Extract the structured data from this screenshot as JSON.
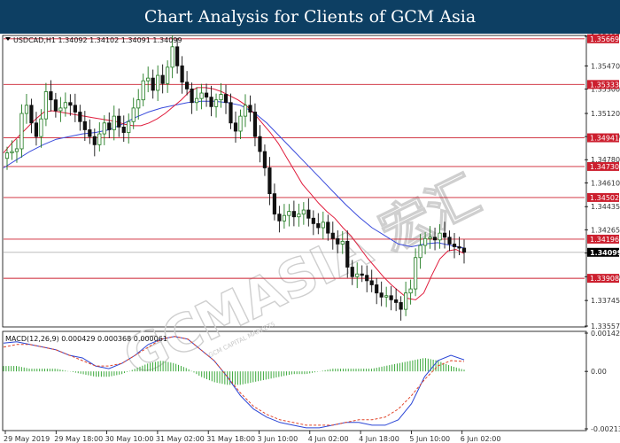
{
  "header": {
    "title": "Chart Analysis for Clients of GCM Asia"
  },
  "watermark": {
    "text": "GCMASIA 宏汇",
    "subtext": "GCM CAPITAL MARKETS"
  },
  "chart_data": [
    {
      "type": "candlestick",
      "symbol_info": "USDCAD,H1  1.34092 1.34102 1.34091 1.34099",
      "ylim": [
        1.33557,
        1.35687
      ],
      "y_ticks": [
        "1.35687",
        "1.35470",
        "1.35300",
        "1.35120",
        "1.34950",
        "1.34780",
        "1.34610",
        "1.34435",
        "1.34265",
        "1.34095",
        "1.33920",
        "1.33745",
        "1.33557"
      ],
      "x_labels": [
        "29 May 2019",
        "29 May 18:00",
        "30 May 10:00",
        "31 May 02:00",
        "31 May 18:00",
        "3 Jun 10:00",
        "4 Jun 02:00",
        "4 Jun 18:00",
        "5 Jun 10:00",
        "6 Jun 02:00"
      ],
      "current_price": "1.34099",
      "levels": [
        {
          "label": "1.35669",
          "value": 1.35669
        },
        {
          "label": "1.35333",
          "value": 1.35333
        },
        {
          "label": "1.34941",
          "value": 1.34941
        },
        {
          "label": "1.34730",
          "value": 1.3473
        },
        {
          "label": "1.34502",
          "value": 1.34502
        },
        {
          "label": "1.34196",
          "value": 1.34196
        },
        {
          "label": "1.33908",
          "value": 1.33908
        }
      ],
      "close_series": [
        1.3483,
        1.3484,
        1.3486,
        1.3512,
        1.3518,
        1.3505,
        1.3495,
        1.3508,
        1.3528,
        1.3522,
        1.3514,
        1.3516,
        1.352,
        1.3518,
        1.3513,
        1.3506,
        1.35,
        1.3495,
        1.3489,
        1.3497,
        1.3505,
        1.35,
        1.351,
        1.3502,
        1.3498,
        1.3506,
        1.3516,
        1.3522,
        1.3536,
        1.3538,
        1.3529,
        1.354,
        1.3534,
        1.3546,
        1.3561,
        1.3547,
        1.3535,
        1.353,
        1.352,
        1.3523,
        1.3527,
        1.3524,
        1.3517,
        1.3522,
        1.3526,
        1.352,
        1.3505,
        1.3499,
        1.351,
        1.3518,
        1.3513,
        1.3495,
        1.3484,
        1.3472,
        1.3453,
        1.3438,
        1.3433,
        1.3437,
        1.344,
        1.3436,
        1.3438,
        1.3441,
        1.3435,
        1.3431,
        1.3428,
        1.3432,
        1.3424,
        1.342,
        1.3416,
        1.3418,
        1.3399,
        1.3392,
        1.3394,
        1.3393,
        1.3389,
        1.3386,
        1.338,
        1.3377,
        1.3378,
        1.3375,
        1.3373,
        1.3368,
        1.338,
        1.3383,
        1.3406,
        1.3415,
        1.342,
        1.3421,
        1.3419,
        1.3424,
        1.3421,
        1.3416,
        1.3414,
        1.3413,
        1.341
      ],
      "ma_red": [
        1.3483,
        1.349,
        1.3496,
        1.3502,
        1.3508,
        1.3513,
        1.3514,
        1.3513,
        1.3512,
        1.3511,
        1.351,
        1.3509,
        1.3508,
        1.3507,
        1.3506,
        1.3504,
        1.3503,
        1.3503,
        1.3505,
        1.3508,
        1.3512,
        1.3517,
        1.3522,
        1.3528,
        1.3531,
        1.3531,
        1.353,
        1.3528,
        1.3525,
        1.3522,
        1.3518,
        1.3512,
        1.3505,
        1.3498,
        1.349,
        1.348,
        1.347,
        1.346,
        1.3453,
        1.3446,
        1.344,
        1.3435,
        1.3428,
        1.3422,
        1.3414,
        1.3406,
        1.3399,
        1.3392,
        1.3386,
        1.3381,
        1.3376,
        1.3375,
        1.338,
        1.3393,
        1.3405,
        1.3411,
        1.3412,
        1.3409
      ],
      "ma_blue": [
        1.3472,
        1.3478,
        1.3484,
        1.3489,
        1.3493,
        1.3495,
        1.3497,
        1.3498,
        1.35,
        1.3504,
        1.3509,
        1.3513,
        1.3516,
        1.3518,
        1.352,
        1.3521,
        1.3521,
        1.352,
        1.3518,
        1.3513,
        1.3505,
        1.3495,
        1.3485,
        1.3475,
        1.3465,
        1.3455,
        1.3445,
        1.3436,
        1.3428,
        1.3422,
        1.3416,
        1.3414,
        1.3416,
        1.3417,
        1.3415,
        1.3413
      ],
      "macd": {
        "label": "MACD(12,26,9) 0.000429 0.000368 0.000061",
        "ylim": [
          -0.002136,
          0.001422
        ],
        "y_ticks": [
          "0.001422",
          "0.00",
          "-0.002136"
        ],
        "main": [
          0.00105,
          0.0011,
          0.001,
          0.0009,
          0.0008,
          0.0006,
          0.0005,
          0.0002,
          0.0001,
          0.0003,
          0.0006,
          0.001,
          0.0012,
          0.0013,
          0.0012,
          0.0008,
          0.0004,
          -0.0002,
          -0.0009,
          -0.0014,
          -0.0017,
          -0.0019,
          -0.002,
          -0.0021,
          -0.0021,
          -0.002,
          -0.0019,
          -0.0019,
          -0.002,
          -0.002,
          -0.0018,
          -0.0012,
          -0.0002,
          0.0004,
          0.0006,
          0.00043
        ],
        "signal": [
          0.0009,
          0.001,
          0.001,
          0.0009,
          0.0008,
          0.0006,
          0.0004,
          0.0002,
          0.0002,
          0.0003,
          0.0006,
          0.0009,
          0.0012,
          0.0013,
          0.0012,
          0.0008,
          0.0004,
          -0.0002,
          -0.0008,
          -0.0013,
          -0.0016,
          -0.0018,
          -0.0019,
          -0.002,
          -0.002,
          -0.002,
          -0.0019,
          -0.0018,
          -0.0018,
          -0.0017,
          -0.0014,
          -0.0009,
          -0.0003,
          0.0002,
          0.0004,
          0.000368
        ],
        "hist": [
          0.0002,
          0.0002,
          0.0001,
          0.0001,
          0.0001,
          0.0,
          -0.0001,
          -0.0002,
          -0.0002,
          -0.0001,
          0.0001,
          0.0003,
          0.0004,
          0.0003,
          0.0001,
          -0.0002,
          -0.0004,
          -0.0005,
          -0.0005,
          -0.0004,
          -0.0003,
          -0.0002,
          -0.0001,
          -0.0001,
          0.0,
          0.0001,
          0.0001,
          0.0001,
          0.0001,
          0.0002,
          0.0003,
          0.0004,
          0.0005,
          0.0004,
          0.0002,
          6.1e-05
        ]
      }
    }
  ],
  "colors": {
    "header_bg": "#0d3f63",
    "bull": "#1f7a1f",
    "bear": "#111111",
    "level": "#cc1f2e",
    "ma_red": "#e01c3c",
    "ma_blue": "#3a4bdc",
    "macd_hist": "#3aa83a",
    "macd_signal": "#e0452a",
    "macd_main": "#2b46d6",
    "price_tag": "#000000"
  }
}
